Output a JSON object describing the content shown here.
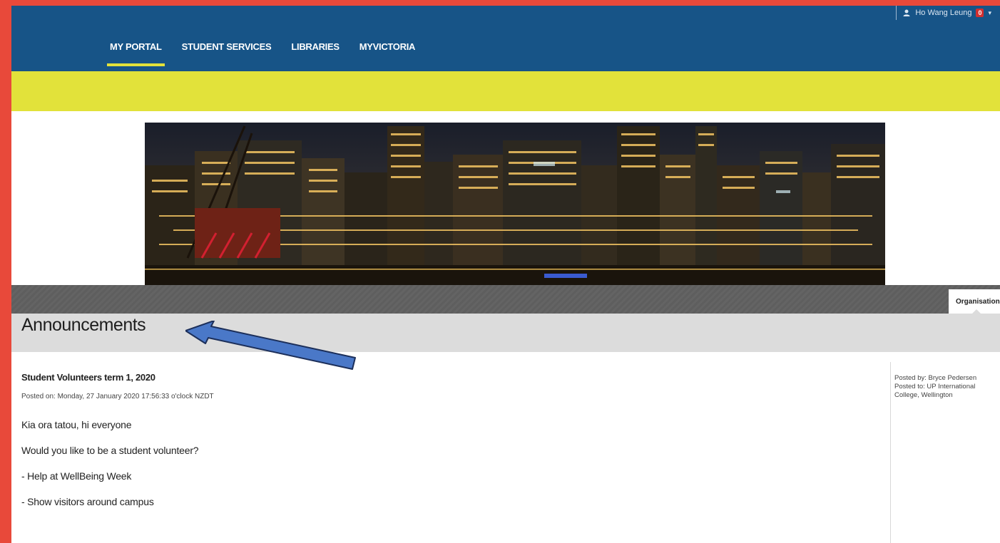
{
  "header": {
    "user_name": "Ho Wang Leung",
    "notification_count": "0",
    "tabs": [
      {
        "label": "MY PORTAL",
        "active": true
      },
      {
        "label": "STUDENT SERVICES",
        "active": false
      },
      {
        "label": "LIBRARIES",
        "active": false
      },
      {
        "label": "MYVICTORIA",
        "active": false
      }
    ]
  },
  "org_tab_label": "Organisation",
  "announcements": {
    "title": "Announcements",
    "post": {
      "title": "Student Volunteers term 1, 2020",
      "posted_on": "Posted on: Monday, 27 January 2020 17:56:33 o'clock NZDT",
      "body": [
        "Kia ora tatou, hi everyone",
        "Would you like to be a student volunteer?",
        "- Help at WellBeing Week",
        "- Show visitors around campus"
      ],
      "posted_by": "Posted by: Bryce Pedersen",
      "posted_to": "Posted to: UP International College, Wellington"
    }
  },
  "colors": {
    "outer_border": "#e8493a",
    "nav_bg": "#175487",
    "accent_yellow": "#e2e23a",
    "annotation_arrow": "#4a78c8"
  }
}
